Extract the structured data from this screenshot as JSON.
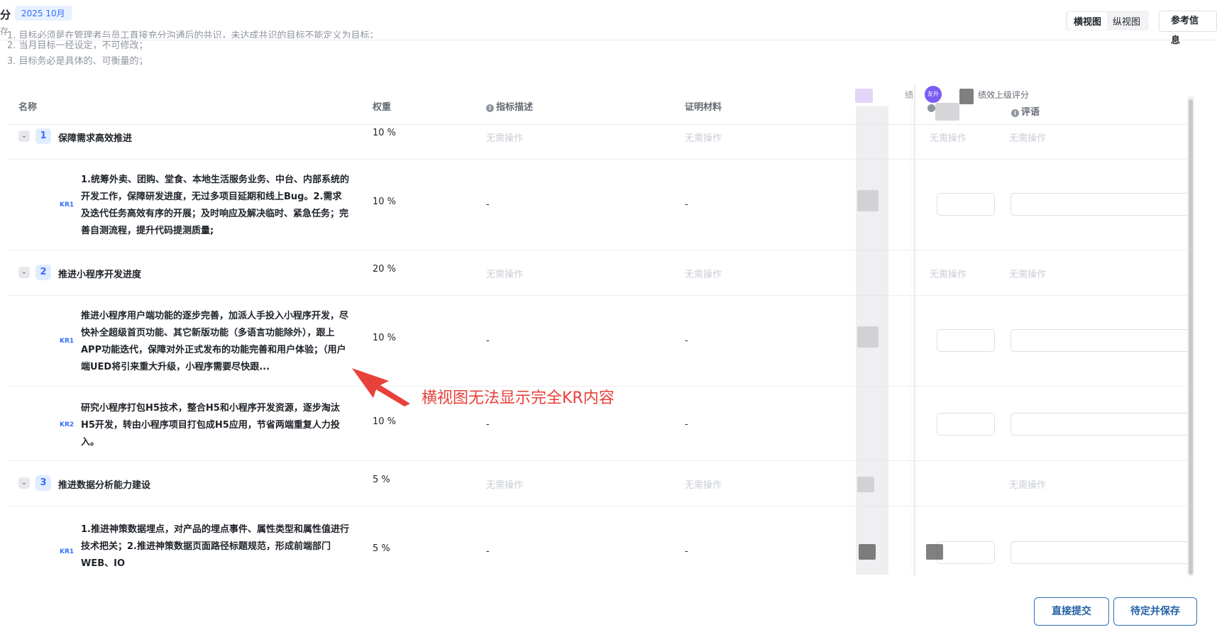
{
  "header": {
    "title": "分",
    "month": "2025 10月",
    "subtitle": "存",
    "views": [
      "横视图",
      "纵视图"
    ],
    "ref_button": "参考信息"
  },
  "rules": [
    "1. 目标必须是在管理者与员工直接充分沟通后的共识，未达成共识的目标不能定义为目标；",
    "2. 当月目标一经设定，不可修改；",
    "3. 目标务必是具体的、可衡量的；"
  ],
  "columns": {
    "name": "名称",
    "weight": "权重",
    "indicator": "指标描述",
    "evidence": "证明材料",
    "blur_partial": "绩",
    "superior_score": "绩效上级评分",
    "comment": "评语",
    "avatar_label": "友升"
  },
  "no_action": "无需操作",
  "dash": "-",
  "objectives": [
    {
      "num": "1",
      "name": "保障需求高效推进",
      "weight": "10  %",
      "krs": [
        {
          "tag": "KR1",
          "weight": "10  %",
          "text": "1.统筹外卖、团购、堂食、本地生活服务业务、中台、内部系统的开发工作，保障研发进度，无过多项目延期和线上Bug。2.需求及迭代任务高效有序的开展；及时响应及解决临时、紧急任务；完善自测流程，提升代码提测质量;"
        }
      ]
    },
    {
      "num": "2",
      "name": "推进小程序开发进度",
      "weight": "20  %",
      "krs": [
        {
          "tag": "KR1",
          "weight": "10  %",
          "text": "推进小程序用户端功能的逐步完善，加派人手投入小程序开发，尽快补全超级首页功能、其它新版功能（多语言功能除外），跟上APP功能迭代，保障对外正式发布的功能完善和用户体验；（用户端UED将引来重大升级，小程序需要尽快跟..."
        },
        {
          "tag": "KR2",
          "weight": "10  %",
          "text": "研究小程序打包H5技术，整合H5和小程序开发资源，逐步淘汰H5开发，转由小程序项目打包成H5应用，节省两端重复人力投入。"
        }
      ]
    },
    {
      "num": "3",
      "name": "推进数据分析能力建设",
      "weight": "5  %",
      "krs": [
        {
          "tag": "KR1",
          "weight": "5  %",
          "text": "1.推进神策数据埋点，对产品的埋点事件、属性类型和属性值进行技术把关；2.推进神策数据页面路径标题规范，形成前端部门WEB、IO"
        }
      ]
    }
  ],
  "annotation": "横视图无法显示完全KR内容",
  "footer": {
    "submit": "直接提交",
    "save": "待定并保存"
  },
  "colors": {
    "accent": "#3370ff",
    "annotation": "#e8413b",
    "button_border": "#2d6fb7"
  }
}
